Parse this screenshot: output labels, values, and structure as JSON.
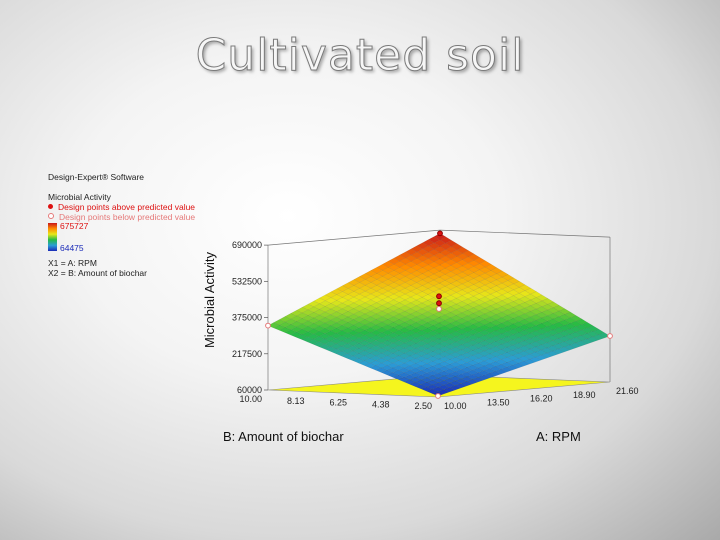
{
  "slide": {
    "title": "Cultivated soil"
  },
  "legend": {
    "software": "Design-Expert® Software",
    "response": "Microbial Activity",
    "above_label": "Design points above predicted value",
    "below_label": "Design points below predicted value",
    "max_value": "675727",
    "min_value": "64475",
    "x1_def": "X1 = A: RPM",
    "x2_def": "X2 = B: Amount of biochar",
    "above_color": "#dd1111",
    "below_color": "#e57979"
  },
  "chart_data": {
    "type": "surface3d",
    "zlabel": "Microbial Activity",
    "xlabel": "A: RPM",
    "ylabel": "B: Amount of biochar",
    "z_ticks": [
      "60000",
      "217500",
      "375000",
      "532500",
      "690000"
    ],
    "z_tick_values": [
      60000,
      217500,
      375000,
      532500,
      690000
    ],
    "x_ticks": [
      "10.00",
      "13.50",
      "16.20",
      "18.90",
      "21.60"
    ],
    "y_ticks": [
      "2.50",
      "4.38",
      "6.25",
      "8.13",
      "10.00"
    ],
    "zlim": [
      60000,
      690000
    ],
    "xlim": [
      10.0,
      21.6
    ],
    "ylim": [
      2.5,
      10.0
    ],
    "surface_corners": {
      "A_low_B_low": 64475,
      "A_high_B_low": 260000,
      "A_low_B_high": 340000,
      "A_high_B_high": 675727
    },
    "design_points": [
      {
        "A": 10.0,
        "B": 2.5,
        "z": 64475,
        "side": "below"
      },
      {
        "A": 21.6,
        "B": 2.5,
        "z": 260000,
        "side": "below"
      },
      {
        "A": 10.0,
        "B": 10.0,
        "z": 340000,
        "side": "below"
      },
      {
        "A": 21.6,
        "B": 10.0,
        "z": 675727,
        "side": "above"
      },
      {
        "A": 15.8,
        "B": 6.25,
        "z": 450000,
        "side": "above"
      },
      {
        "A": 15.8,
        "B": 6.25,
        "z": 420000,
        "side": "above"
      },
      {
        "A": 15.8,
        "B": 6.25,
        "z": 395000,
        "side": "below"
      }
    ],
    "colormap": [
      "#1a2ab8",
      "#2b9dd6",
      "#26bb44",
      "#e7e71a",
      "#ff8a00",
      "#c8171b"
    ],
    "floor_color": "#f5f51e"
  }
}
